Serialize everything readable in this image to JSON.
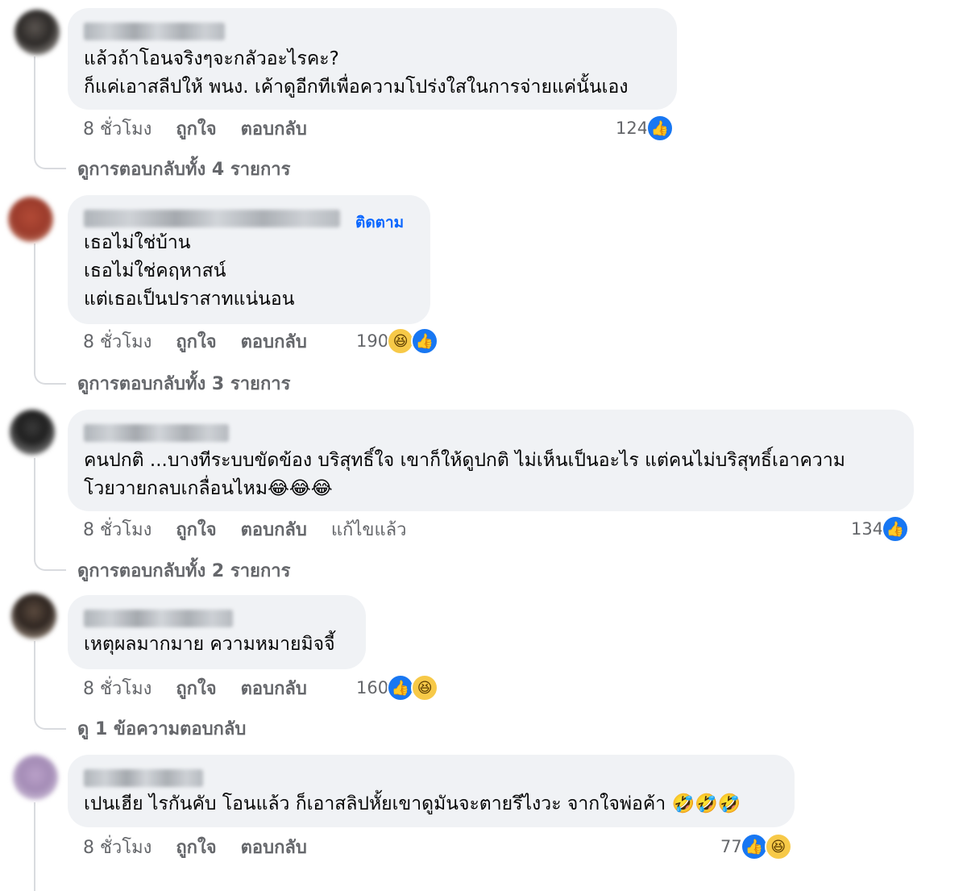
{
  "comments": [
    {
      "text_lines": [
        "แล้วถ้าโอนจริงๆจะกลัวอะไรคะ?",
        "ก็แค่เอาสลีปให้ พนง. เค้าดูอีกทีเพื่อความโปร่งใสในการจ่ายแค่นั้นเอง"
      ],
      "time": "8 ชั่วโมง",
      "like_label": "ถูกใจ",
      "reply_label": "ตอบกลับ",
      "reaction_count": "124",
      "reaction_icons": [
        "like"
      ],
      "replies_link": "ดูการตอบกลับทั้ง 4 รายการ"
    },
    {
      "follow_label": "ติดตาม",
      "text_lines": [
        "เธอไม่ใช่บ้าน",
        "เธอไม่ใช่คฤหาสน์",
        "แต่เธอเป็นปราสาทแน่นอน"
      ],
      "time": "8 ชั่วโมง",
      "like_label": "ถูกใจ",
      "reply_label": "ตอบกลับ",
      "reaction_count": "190",
      "reaction_icons": [
        "haha",
        "like"
      ],
      "replies_link": "ดูการตอบกลับทั้ง 3 รายการ"
    },
    {
      "text_lines": [
        "คนปกติ ...บางทีระบบขัดข้อง บริสุทธิ์ใจ เขาก็ให้ดูปกติ ไม่เห็นเป็นอะไร แต่คนไม่บริสุทธิ์เอาความ",
        "โวยวายกลบเกลื่อนไหม😂😂😂"
      ],
      "time": "8 ชั่วโมง",
      "like_label": "ถูกใจ",
      "reply_label": "ตอบกลับ",
      "edited_label": "แก้ไขแล้ว",
      "reaction_count": "134",
      "reaction_icons": [
        "like"
      ],
      "replies_link": "ดูการตอบกลับทั้ง 2 รายการ"
    },
    {
      "text_lines": [
        "เหตุผลมากมาย ความหมายมิจจี้"
      ],
      "time": "8 ชั่วโมง",
      "like_label": "ถูกใจ",
      "reply_label": "ตอบกลับ",
      "reaction_count": "160",
      "reaction_icons": [
        "like",
        "haha"
      ],
      "replies_link": "ดู 1 ข้อความตอบกลับ"
    },
    {
      "text_lines": [
        "เปนเฮีย ไรกันคับ โอนแล้ว ก็เอาสลิปหั้ยเขาดูมันจะตายรึไงวะ จากใจพ่อค้า 🤣🤣🤣"
      ],
      "time": "8 ชั่วโมง",
      "like_label": "ถูกใจ",
      "reply_label": "ตอบกลับ",
      "reaction_count": "77",
      "reaction_icons": [
        "like",
        "haha"
      ]
    }
  ],
  "icons": {
    "like": "thumbs-up",
    "haha": "laughing-face"
  },
  "colors": {
    "bubble": "#f0f2f5",
    "meta": "#65676b",
    "accent": "#0866ff"
  }
}
